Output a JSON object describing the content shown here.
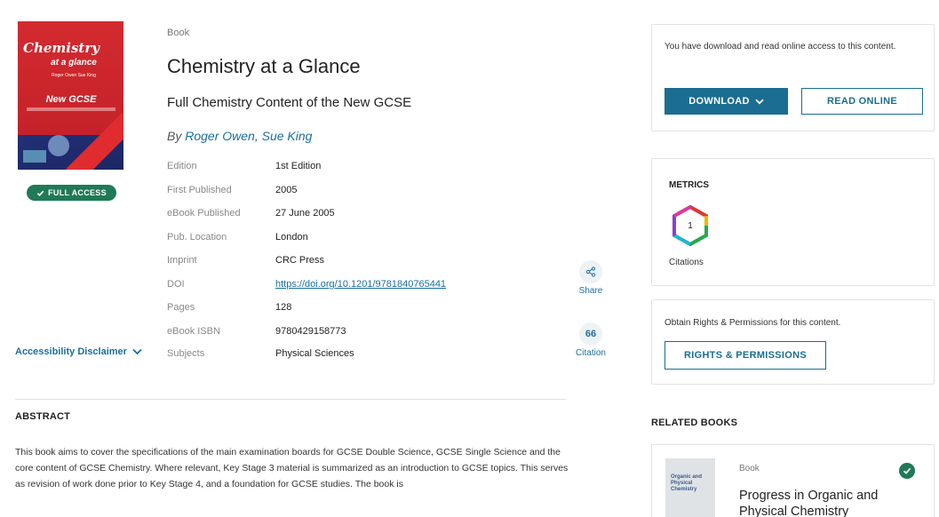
{
  "cover": {
    "title_line1": "Chemistry",
    "title_line2": "at a glance",
    "authors_line": "Roger Owen Sue King",
    "tagline": "New GCSE"
  },
  "access_badge": {
    "icon": "check-icon",
    "label": "FULL ACCESS"
  },
  "accessibility": {
    "label": "Accessibility Disclaimer"
  },
  "book": {
    "type": "Book",
    "title": "Chemistry at a Glance",
    "subtitle": "Full Chemistry Content of the New GCSE",
    "by": "By",
    "authors": [
      "Roger Owen",
      "Sue King"
    ]
  },
  "metadata": [
    {
      "key": "Edition",
      "value": "1st Edition"
    },
    {
      "key": "First Published",
      "value": "2005"
    },
    {
      "key": "eBook Published",
      "value": "27 June 2005"
    },
    {
      "key": "Pub. Location",
      "value": "London"
    },
    {
      "key": "Imprint",
      "value": "CRC Press"
    },
    {
      "key": "DOI",
      "value": "https://doi.org/10.1201/9781840765441"
    },
    {
      "key": "Pages",
      "value": "128"
    },
    {
      "key": "eBook ISBN",
      "value": "9780429158773"
    },
    {
      "key": "Subjects",
      "value": "Physical Sciences"
    }
  ],
  "actions": {
    "share_label": "Share",
    "citation_label": "Citation",
    "citation_glyph": "66"
  },
  "abstract": {
    "heading": "ABSTRACT",
    "text": "This book aims to cover the specifications of the main examination boards for GCSE Double Science, GCSE Single Science and the core content of GCSE Chemistry. Where relevant, Key Stage 3 material is summarized as an introduction to GCSE topics. This serves as revision of work done prior to Key Stage 4, and a foundation for GCSE studies. The book is"
  },
  "access_card": {
    "text": "You have download and read online access to this content.",
    "download_label": "DOWNLOAD",
    "read_online_label": "READ ONLINE"
  },
  "metrics": {
    "heading": "METRICS",
    "citations_count": "1",
    "citations_label": "Citations"
  },
  "rights": {
    "text": "Obtain Rights & Permissions for this content.",
    "button_label": "RIGHTS & PERMISSIONS"
  },
  "related": {
    "heading": "RELATED BOOKS",
    "items": [
      {
        "type": "Book",
        "title": "Progress in Organic and Physical Chemistry",
        "cover_text": "Organic and Physical Chemistry"
      }
    ]
  },
  "colors": {
    "accent": "#1b6e91",
    "link": "#1a6fa0",
    "success": "#1f7a55"
  }
}
